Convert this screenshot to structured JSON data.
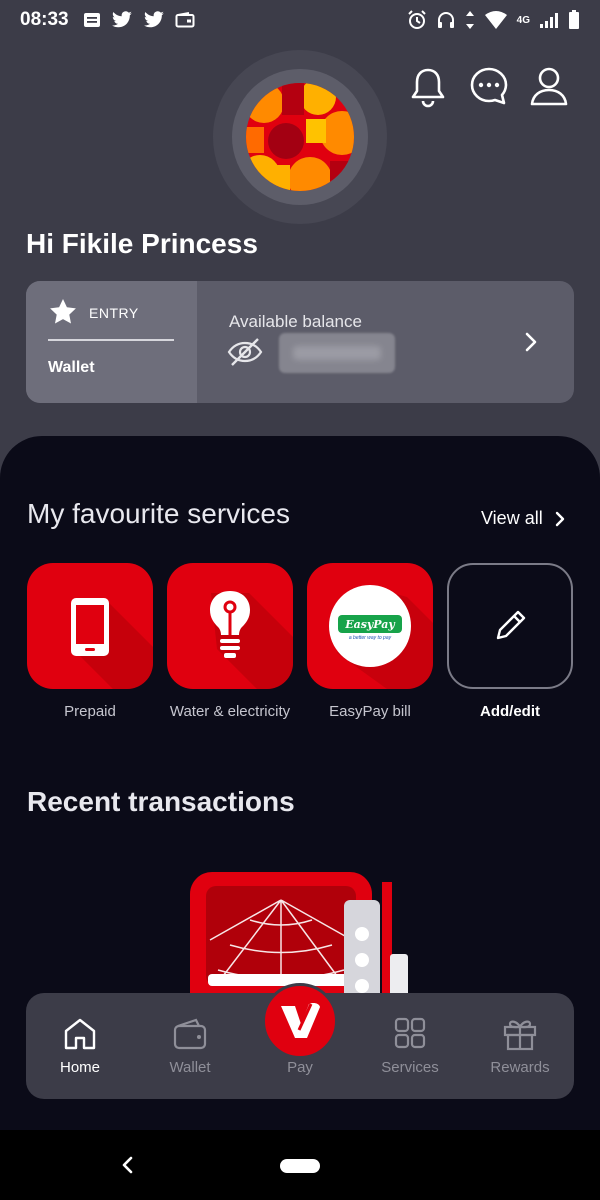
{
  "status_bar": {
    "time": "08:33",
    "network": "4G"
  },
  "header": {
    "greeting": "Hi Fikile Princess"
  },
  "wallet_card": {
    "tier": "ENTRY",
    "wallet_label": "Wallet",
    "balance_label": "Available balance"
  },
  "favourites": {
    "title": "My favourite services",
    "view_all": "View all",
    "services": [
      {
        "label": "Prepaid",
        "icon": "phone-icon"
      },
      {
        "label": "Water & electricity",
        "icon": "lightbulb-icon"
      },
      {
        "label": "EasyPay bill",
        "icon": "easypay-logo"
      },
      {
        "label": "Add/edit",
        "icon": "pencil-icon"
      }
    ],
    "easypay_logo_text": "EasyPay",
    "easypay_tagline": "a better way to pay"
  },
  "recent": {
    "title": "Recent transactions"
  },
  "bottom_nav": {
    "items": [
      {
        "label": "Home",
        "icon": "home-icon"
      },
      {
        "label": "Wallet",
        "icon": "wallet-icon"
      },
      {
        "label": "Pay",
        "icon": "pay-logo"
      },
      {
        "label": "Services",
        "icon": "grid-icon"
      },
      {
        "label": "Rewards",
        "icon": "gift-icon"
      }
    ],
    "active": "Home"
  },
  "colors": {
    "brand_red": "#e0000f",
    "background": "#3c3c48",
    "panel_dark": "#0b0b18"
  }
}
